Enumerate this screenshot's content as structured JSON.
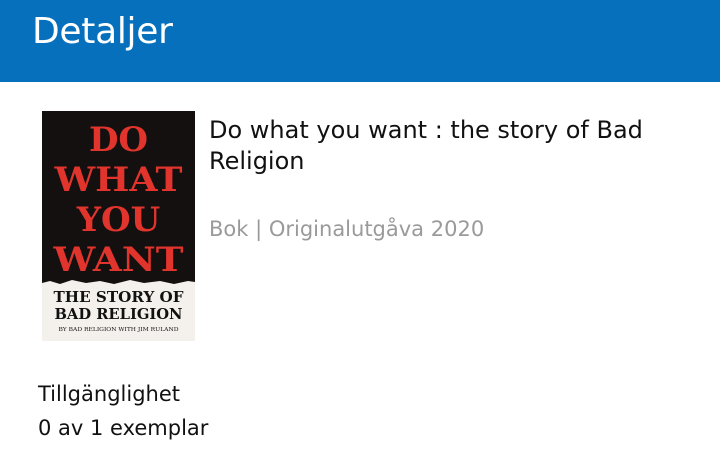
{
  "header": {
    "title": "Detaljer"
  },
  "book": {
    "title": "Do what you want : the story of Bad Religion",
    "meta": "Bok | Originalutgåva 2020",
    "cover": {
      "line1": "DO",
      "line2": "WHAT",
      "line3": "YOU",
      "line4": "WANT",
      "subtitle1": "THE STORY OF",
      "subtitle2": "BAD RELIGION",
      "byline": "BY BAD RELIGION WITH JIM RULAND",
      "colors": {
        "background": "#141010",
        "title": "#e0342c",
        "subtitle": "#111111",
        "paper": "#f4f1ec"
      }
    }
  },
  "availability": {
    "heading": "Tillgänglighet",
    "count": "0 av 1 exemplar"
  },
  "colors": {
    "app_bar": "#0670bd",
    "meta_text": "#9a9a9a"
  }
}
